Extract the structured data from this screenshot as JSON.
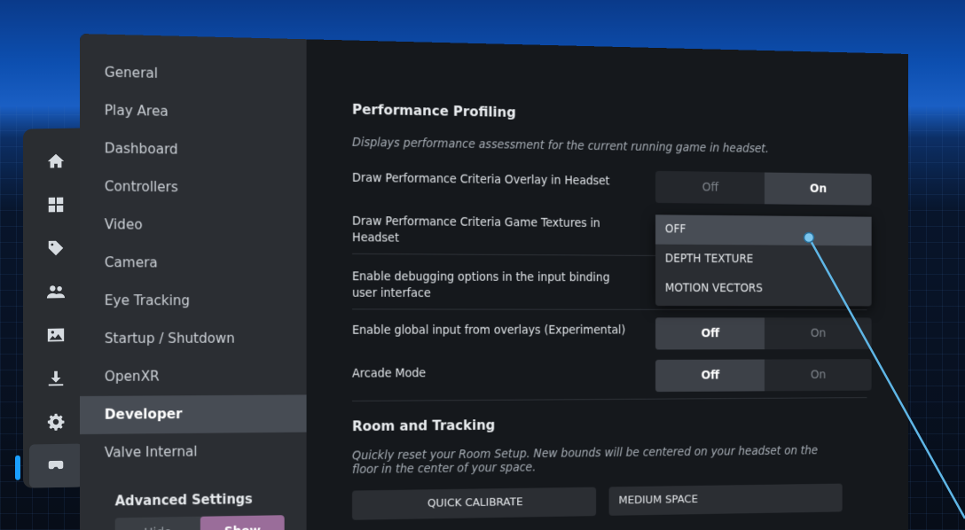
{
  "rail": {
    "icons": [
      "home-icon",
      "grid-icon",
      "tag-icon",
      "friends-icon",
      "media-icon",
      "download-icon",
      "gear-icon",
      "headset-icon"
    ]
  },
  "nav": {
    "items": [
      "General",
      "Play Area",
      "Dashboard",
      "Controllers",
      "Video",
      "Camera",
      "Eye Tracking",
      "Startup / Shutdown",
      "OpenXR",
      "Developer",
      "Valve Internal"
    ],
    "active": "Developer",
    "advanced_label": "Advanced Settings",
    "advanced_hide": "Hide",
    "advanced_show": "Show"
  },
  "perf": {
    "title": "Performance Profiling",
    "desc": "Displays performance assessment for the current running game in headset.",
    "overlay_label": "Draw Performance Criteria Overlay in Headset",
    "overlay_off": "Off",
    "overlay_on": "On",
    "textures_label": "Draw Performance Criteria Game Textures in Headset",
    "dropdown_options": [
      "OFF",
      "DEPTH TEXTURE",
      "MOTION VECTORS"
    ],
    "debug_label": "Enable debugging options in the input binding user interface",
    "global_label": "Enable global input from overlays (Experimental)",
    "global_off": "Off",
    "global_on": "On",
    "arcade_label": "Arcade Mode",
    "arcade_off": "Off",
    "arcade_on": "On"
  },
  "room": {
    "title": "Room and Tracking",
    "desc": "Quickly reset your Room Setup. New bounds will be centered on your headset on the floor in the center of your space.",
    "quick_calibrate": "QUICK CALIBRATE",
    "medium_space": "MEDIUM SPACE"
  },
  "colors": {
    "accent": "#1a9fff",
    "show_toggle": "#9a6d9a",
    "pointer": "#5fb6e6"
  }
}
